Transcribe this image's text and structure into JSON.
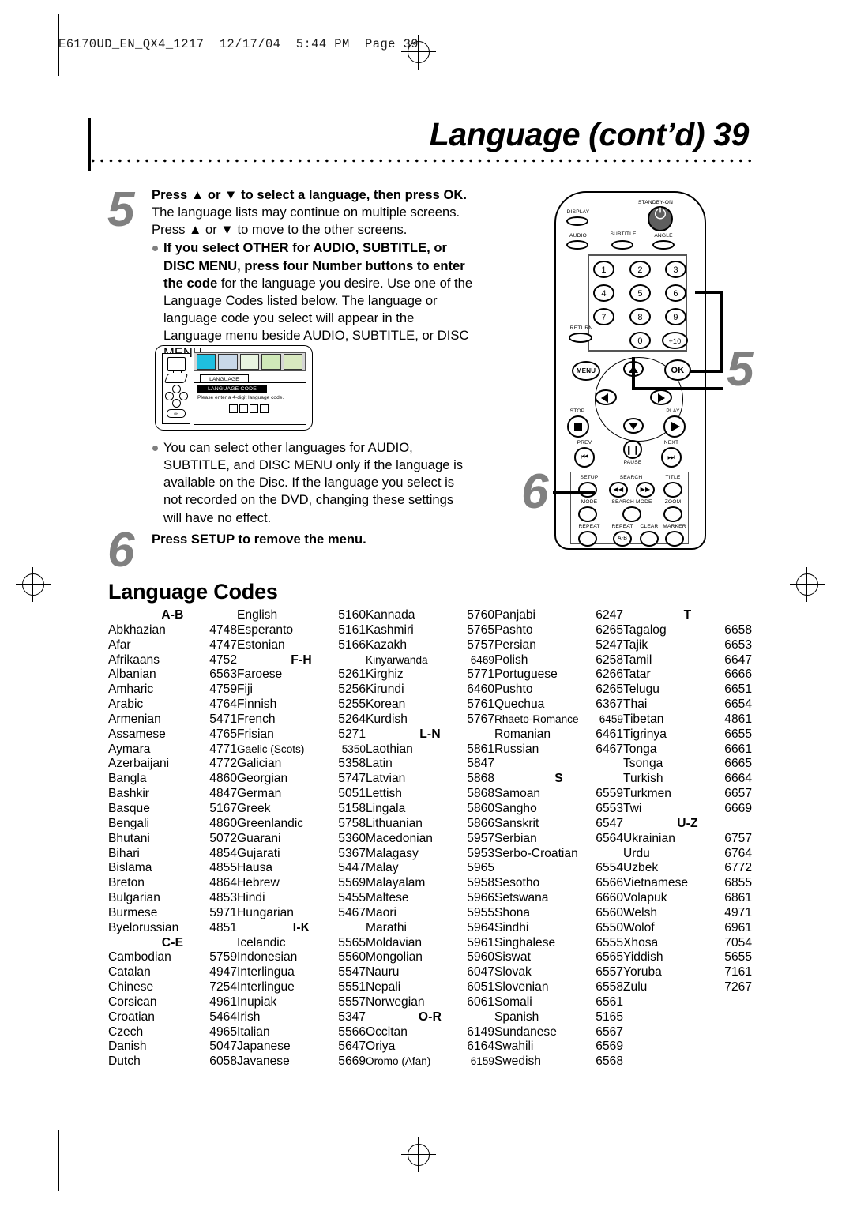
{
  "file_header": "E6170UD_EN_QX4_1217  12/17/04  5:44 PM  Page 39",
  "page_title": "Language (cont’d)  39",
  "steps": [
    {
      "number": "5",
      "lead_bold": "Press ▲ or ▼ to select a language, then press OK.",
      "lead_rest": " The language lists may continue on multiple screens. Press ▲ or ▼ to move to the other screens.",
      "bullet_bold": "If you select OTHER for AUDIO, SUBTITLE, or DISC MENU, press four Number buttons to enter the code",
      "bullet_rest": " for the language you desire. Use one of the Language Codes listed below. The language or language code you select will appear in the Language menu beside AUDIO, SUBTITLE, or DISC MENU.",
      "bullet2": "You can select other languages for AUDIO, SUBTITLE, and DISC MENU only if the language is available on the Disc. If the language you select is not recorded on the DVD, changing these settings will have no effect."
    },
    {
      "number": "6",
      "lead_bold": "Press SETUP to remove the menu.",
      "lead_rest": ""
    }
  ],
  "osd": {
    "tab_label": "LANGUAGE",
    "panel_title": "LANGUAGE CODE",
    "panel_message": "Please enter a 4-digit language code.",
    "ok_label": "OK",
    "digit_count": 4
  },
  "remote": {
    "callout_top": "5",
    "callout_bottom": "6",
    "buttons": {
      "display": "DISPLAY",
      "standby": "STANDBY-ON",
      "audio": "AUDIO",
      "subtitle": "SUBTITLE",
      "angle": "ANGLE",
      "numbers": [
        "1",
        "2",
        "3",
        "4",
        "5",
        "6",
        "7",
        "8",
        "9",
        "0",
        "+10"
      ],
      "return": "RETURN",
      "menu": "MENU",
      "ok": "OK",
      "stop": "STOP",
      "play": "PLAY",
      "prev": "PREV",
      "pause": "PAUSE",
      "next": "NEXT",
      "setup": "SETUP",
      "search": "SEARCH",
      "title": "TITLE",
      "mode": "MODE",
      "search_mode": "SEARCH MODE",
      "zoom": "ZOOM",
      "repeat": "REPEAT",
      "repeat_ab": "REPEAT",
      "repeat_ab_inner": "A-B",
      "clear": "CLEAR",
      "marker": "MARKER"
    }
  },
  "language_codes": {
    "title": "Language Codes",
    "columns": [
      {
        "entries": [
          {
            "type": "header",
            "name": "A-B"
          },
          {
            "name": "Abkhazian",
            "code": "4748"
          },
          {
            "name": "Afar",
            "code": "4747"
          },
          {
            "name": "Afrikaans",
            "code": "4752"
          },
          {
            "name": "Albanian",
            "code": "6563"
          },
          {
            "name": "Amharic",
            "code": "4759"
          },
          {
            "name": "Arabic",
            "code": "4764"
          },
          {
            "name": "Armenian",
            "code": "5471"
          },
          {
            "name": "Assamese",
            "code": "4765"
          },
          {
            "name": "Aymara",
            "code": "4771"
          },
          {
            "name": "Azerbaijani",
            "code": "4772"
          },
          {
            "name": "Bangla",
            "code": "4860"
          },
          {
            "name": "Bashkir",
            "code": "4847"
          },
          {
            "name": "Basque",
            "code": "5167"
          },
          {
            "name": "Bengali",
            "code": "4860"
          },
          {
            "name": "Bhutani",
            "code": "5072"
          },
          {
            "name": "Bihari",
            "code": "4854"
          },
          {
            "name": "Bislama",
            "code": "4855"
          },
          {
            "name": "Breton",
            "code": "4864"
          },
          {
            "name": "Bulgarian",
            "code": "4853"
          },
          {
            "name": "Burmese",
            "code": "5971"
          },
          {
            "name": "Byelorussian",
            "code": "4851"
          },
          {
            "type": "header",
            "name": "C-E"
          },
          {
            "name": "Cambodian",
            "code": "5759"
          },
          {
            "name": "Catalan",
            "code": "4947"
          },
          {
            "name": "Chinese",
            "code": "7254"
          },
          {
            "name": "Corsican",
            "code": "4961"
          },
          {
            "name": "Croatian",
            "code": "5464"
          },
          {
            "name": "Czech",
            "code": "4965"
          },
          {
            "name": "Danish",
            "code": "5047"
          },
          {
            "name": "Dutch",
            "code": "6058"
          }
        ]
      },
      {
        "entries": [
          {
            "name": "English",
            "code": "5160"
          },
          {
            "name": "Esperanto",
            "code": "5161"
          },
          {
            "name": "Estonian",
            "code": "5166"
          },
          {
            "type": "header",
            "name": "F-H"
          },
          {
            "name": "Faroese",
            "code": "5261"
          },
          {
            "name": "Fiji",
            "code": "5256"
          },
          {
            "name": "Finnish",
            "code": "5255"
          },
          {
            "name": "French",
            "code": "5264"
          },
          {
            "name": "Frisian",
            "code": "5271"
          },
          {
            "name": "Gaelic (Scots)",
            "code": "5350",
            "tight": true
          },
          {
            "name": "Galician",
            "code": "5358"
          },
          {
            "name": "Georgian",
            "code": "5747"
          },
          {
            "name": "German",
            "code": "5051"
          },
          {
            "name": "Greek",
            "code": "5158"
          },
          {
            "name": "Greenlandic",
            "code": "5758"
          },
          {
            "name": "Guarani",
            "code": "5360"
          },
          {
            "name": "Gujarati",
            "code": "5367"
          },
          {
            "name": "Hausa",
            "code": "5447"
          },
          {
            "name": "Hebrew",
            "code": "5569"
          },
          {
            "name": "Hindi",
            "code": "5455"
          },
          {
            "name": "Hungarian",
            "code": "5467"
          },
          {
            "type": "header",
            "name": "I-K"
          },
          {
            "name": "Icelandic",
            "code": "5565"
          },
          {
            "name": "Indonesian",
            "code": "5560"
          },
          {
            "name": "Interlingua",
            "code": "5547"
          },
          {
            "name": "Interlingue",
            "code": "5551"
          },
          {
            "name": "Inupiak",
            "code": "5557"
          },
          {
            "name": "Irish",
            "code": "5347"
          },
          {
            "name": "Italian",
            "code": "5566"
          },
          {
            "name": "Japanese",
            "code": "5647"
          },
          {
            "name": "Javanese",
            "code": "5669"
          }
        ]
      },
      {
        "entries": [
          {
            "name": "Kannada",
            "code": "5760"
          },
          {
            "name": "Kashmiri",
            "code": "5765"
          },
          {
            "name": "Kazakh",
            "code": "5757"
          },
          {
            "name": "Kinyarwanda",
            "code": "6469",
            "tight": true
          },
          {
            "name": "Kirghiz",
            "code": "5771"
          },
          {
            "name": "Kirundi",
            "code": "6460"
          },
          {
            "name": "Korean",
            "code": "5761"
          },
          {
            "name": "Kurdish",
            "code": "5767"
          },
          {
            "type": "header",
            "name": "L-N"
          },
          {
            "name": "Laothian",
            "code": "5861"
          },
          {
            "name": "Latin",
            "code": "5847"
          },
          {
            "name": "Latvian",
            "code": "5868"
          },
          {
            "name": "Lettish",
            "code": "5868"
          },
          {
            "name": "Lingala",
            "code": "5860"
          },
          {
            "name": "Lithuanian",
            "code": "5866"
          },
          {
            "name": "Macedonian",
            "code": "5957"
          },
          {
            "name": "Malagasy",
            "code": "5953"
          },
          {
            "name": "Malay",
            "code": "5965"
          },
          {
            "name": "Malayalam",
            "code": "5958"
          },
          {
            "name": "Maltese",
            "code": "5966"
          },
          {
            "name": "Maori",
            "code": "5955"
          },
          {
            "name": "Marathi",
            "code": "5964"
          },
          {
            "name": "Moldavian",
            "code": "5961"
          },
          {
            "name": "Mongolian",
            "code": "5960"
          },
          {
            "name": "Nauru",
            "code": "6047"
          },
          {
            "name": "Nepali",
            "code": "6051"
          },
          {
            "name": "Norwegian",
            "code": "6061"
          },
          {
            "type": "header",
            "name": "O-R"
          },
          {
            "name": "Occitan",
            "code": "6149"
          },
          {
            "name": "Oriya",
            "code": "6164"
          },
          {
            "name": "Oromo (Afan)",
            "code": "6159",
            "tight": true
          }
        ]
      },
      {
        "entries": [
          {
            "name": "Panjabi",
            "code": "6247"
          },
          {
            "name": "Pashto",
            "code": "6265"
          },
          {
            "name": "Persian",
            "code": "5247"
          },
          {
            "name": "Polish",
            "code": "6258"
          },
          {
            "name": "Portuguese",
            "code": "6266"
          },
          {
            "name": "Pushto",
            "code": "6265"
          },
          {
            "name": "Quechua",
            "code": "6367"
          },
          {
            "name": "Rhaeto-Romance",
            "code": "6459",
            "tight": true
          },
          {
            "name": "Romanian",
            "code": "6461"
          },
          {
            "name": "Russian",
            "code": "6467"
          },
          {
            "type": "blank"
          },
          {
            "type": "header",
            "name": "S"
          },
          {
            "name": "Samoan",
            "code": "6559"
          },
          {
            "name": "Sangho",
            "code": "6553"
          },
          {
            "name": "Sanskrit",
            "code": "6547"
          },
          {
            "name": "Serbian",
            "code": "6564"
          },
          {
            "name": "Serbo-Croatian",
            "code": ""
          },
          {
            "name": "",
            "code": "6554"
          },
          {
            "name": "Sesotho",
            "code": "6566"
          },
          {
            "name": "Setswana",
            "code": "6660"
          },
          {
            "name": "Shona",
            "code": "6560"
          },
          {
            "name": "Sindhi",
            "code": "6550"
          },
          {
            "name": "Singhalese",
            "code": "6555"
          },
          {
            "name": "Siswat",
            "code": "6565"
          },
          {
            "name": "Slovak",
            "code": "6557"
          },
          {
            "name": "Slovenian",
            "code": "6558"
          },
          {
            "name": "Somali",
            "code": "6561"
          },
          {
            "name": "Spanish",
            "code": "5165"
          },
          {
            "name": "Sundanese",
            "code": "6567"
          },
          {
            "name": "Swahili",
            "code": "6569"
          },
          {
            "name": "Swedish",
            "code": "6568"
          }
        ]
      },
      {
        "entries": [
          {
            "type": "header",
            "name": "T"
          },
          {
            "name": "Tagalog",
            "code": "6658"
          },
          {
            "name": "Tajik",
            "code": "6653"
          },
          {
            "name": "Tamil",
            "code": "6647"
          },
          {
            "name": "Tatar",
            "code": "6666"
          },
          {
            "name": "Telugu",
            "code": "6651"
          },
          {
            "name": "Thai",
            "code": "6654"
          },
          {
            "name": "Tibetan",
            "code": "4861"
          },
          {
            "name": "Tigrinya",
            "code": "6655"
          },
          {
            "name": "Tonga",
            "code": "6661"
          },
          {
            "name": "Tsonga",
            "code": "6665"
          },
          {
            "name": "Turkish",
            "code": "6664"
          },
          {
            "name": "Turkmen",
            "code": "6657"
          },
          {
            "name": "Twi",
            "code": "6669"
          },
          {
            "type": "header",
            "name": "U-Z"
          },
          {
            "name": "Ukrainian",
            "code": "6757"
          },
          {
            "name": "Urdu",
            "code": "6764"
          },
          {
            "name": "Uzbek",
            "code": "6772"
          },
          {
            "name": "Vietnamese",
            "code": "6855"
          },
          {
            "name": "Volapuk",
            "code": "6861"
          },
          {
            "name": "Welsh",
            "code": "4971"
          },
          {
            "name": "Wolof",
            "code": "6961"
          },
          {
            "name": "Xhosa",
            "code": "7054"
          },
          {
            "name": "Yiddish",
            "code": "5655"
          },
          {
            "name": "Yoruba",
            "code": "7161"
          },
          {
            "name": "Zulu",
            "code": "7267"
          }
        ]
      }
    ]
  }
}
